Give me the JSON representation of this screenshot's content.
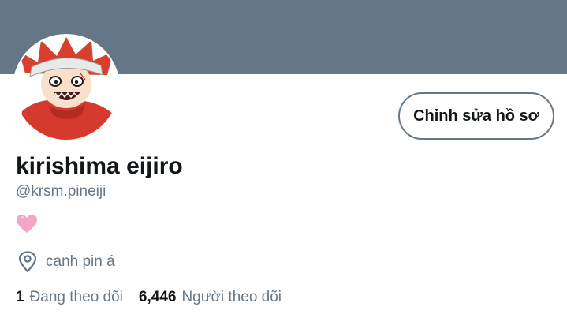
{
  "profile": {
    "name": "kirishima eijiro",
    "handle": "@krsm.pineiji",
    "bio_emoji": "pink-heart-icon",
    "location": "cạnh pin á",
    "edit_label": "Chỉnh sửa hồ sơ"
  },
  "stats": {
    "following_count": "1",
    "following_label": "Đang theo dõi",
    "followers_count": "6,446",
    "followers_label": "Người theo dõi"
  },
  "colors": {
    "banner": "#657786",
    "text_primary": "#14171a",
    "text_secondary": "#657786",
    "heart": "#f4a6c6"
  }
}
